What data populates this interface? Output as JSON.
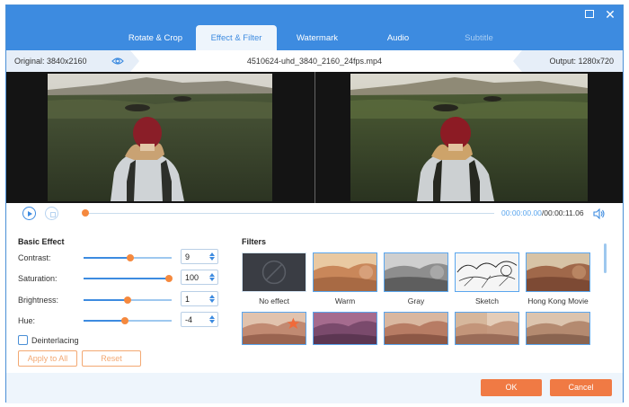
{
  "window": {
    "tabs": [
      {
        "label": "Rotate & Crop",
        "state": "normal"
      },
      {
        "label": "Effect & Filter",
        "state": "active"
      },
      {
        "label": "Watermark",
        "state": "normal"
      },
      {
        "label": "Audio",
        "state": "normal"
      },
      {
        "label": "Subtitle",
        "state": "disabled"
      }
    ]
  },
  "info": {
    "original": "Original: 3840x2160",
    "filename": "4510624-uhd_3840_2160_24fps.mp4",
    "output": "Output: 1280x720"
  },
  "player": {
    "current_time": "00:00:00.00",
    "total_time": "/00:00:11.06",
    "progress": 0.0
  },
  "basic_effect": {
    "title": "Basic Effect",
    "controls": [
      {
        "label": "Contrast:",
        "value": "9",
        "slider_fraction": 0.53
      },
      {
        "label": "Saturation:",
        "value": "100",
        "slider_fraction": 0.97
      },
      {
        "label": "Brightness:",
        "value": "1",
        "slider_fraction": 0.5
      },
      {
        "label": "Hue:",
        "value": "-4",
        "slider_fraction": 0.47
      }
    ],
    "deinterlacing_label": "Deinterlacing",
    "deinterlacing_checked": false,
    "apply_all_label": "Apply to All",
    "reset_label": "Reset"
  },
  "filters": {
    "title": "Filters",
    "items": [
      {
        "label": "No effect"
      },
      {
        "label": "Warm"
      },
      {
        "label": "Gray"
      },
      {
        "label": "Sketch"
      },
      {
        "label": "Hong Kong Movie"
      },
      {
        "label": ""
      },
      {
        "label": ""
      },
      {
        "label": ""
      },
      {
        "label": ""
      },
      {
        "label": ""
      }
    ]
  },
  "footer": {
    "ok_label": "OK",
    "cancel_label": "Cancel"
  },
  "colors": {
    "accent": "#3d8be0",
    "orange": "#f07a44"
  }
}
